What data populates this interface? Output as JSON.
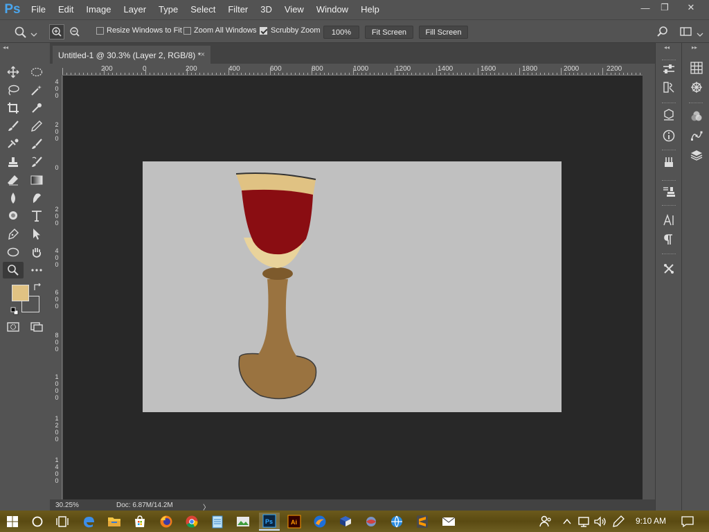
{
  "app": {
    "logo": "Ps"
  },
  "menu": [
    "File",
    "Edit",
    "Image",
    "Layer",
    "Type",
    "Select",
    "Filter",
    "3D",
    "View",
    "Window",
    "Help"
  ],
  "window_controls": {
    "minimize": "—",
    "restore": "❐",
    "close": "✕"
  },
  "options_bar": {
    "tool_icon": "zoom-icon",
    "zoom_in_icon": "zoom-in-icon",
    "zoom_out_icon": "zoom-out-icon",
    "resize_windows": {
      "label": "Resize Windows to Fit",
      "checked": false
    },
    "zoom_all_windows": {
      "label": "Zoom All Windows",
      "checked": false
    },
    "scrubby_zoom": {
      "label": "Scrubby Zoom",
      "checked": true
    },
    "percent_button": "100%",
    "fit_screen": "Fit Screen",
    "fill_screen": "Fill Screen"
  },
  "document": {
    "tab_title": "Untitled-1 @ 30.3% (Layer 2, RGB/8) *",
    "tab_close": "×",
    "canvas_color": "#c0c0c0"
  },
  "rulers": {
    "horizontal": [
      "200",
      "0",
      "200",
      "400",
      "600",
      "800",
      "1000",
      "1200",
      "1400",
      "1600",
      "1800",
      "2000",
      "2200"
    ],
    "vertical": [
      "4 0 0",
      "2 0 0",
      "0",
      "2 0 0",
      "4 0 0",
      "6 0 0",
      "8 0 0",
      "1 0 0 0",
      "1 2 0 0",
      "1 4 0 0"
    ]
  },
  "status": {
    "zoom": "30.25%",
    "doc": "Doc: 6.87M/14.2M",
    "arrow": "〉"
  },
  "colors": {
    "foreground": "#e0c283",
    "background": "#535353",
    "wine": "#8a0d12",
    "glass_rim": "#e0c283",
    "stem": "#9a7340"
  },
  "taskbar": {
    "time": "9:10 AM"
  }
}
